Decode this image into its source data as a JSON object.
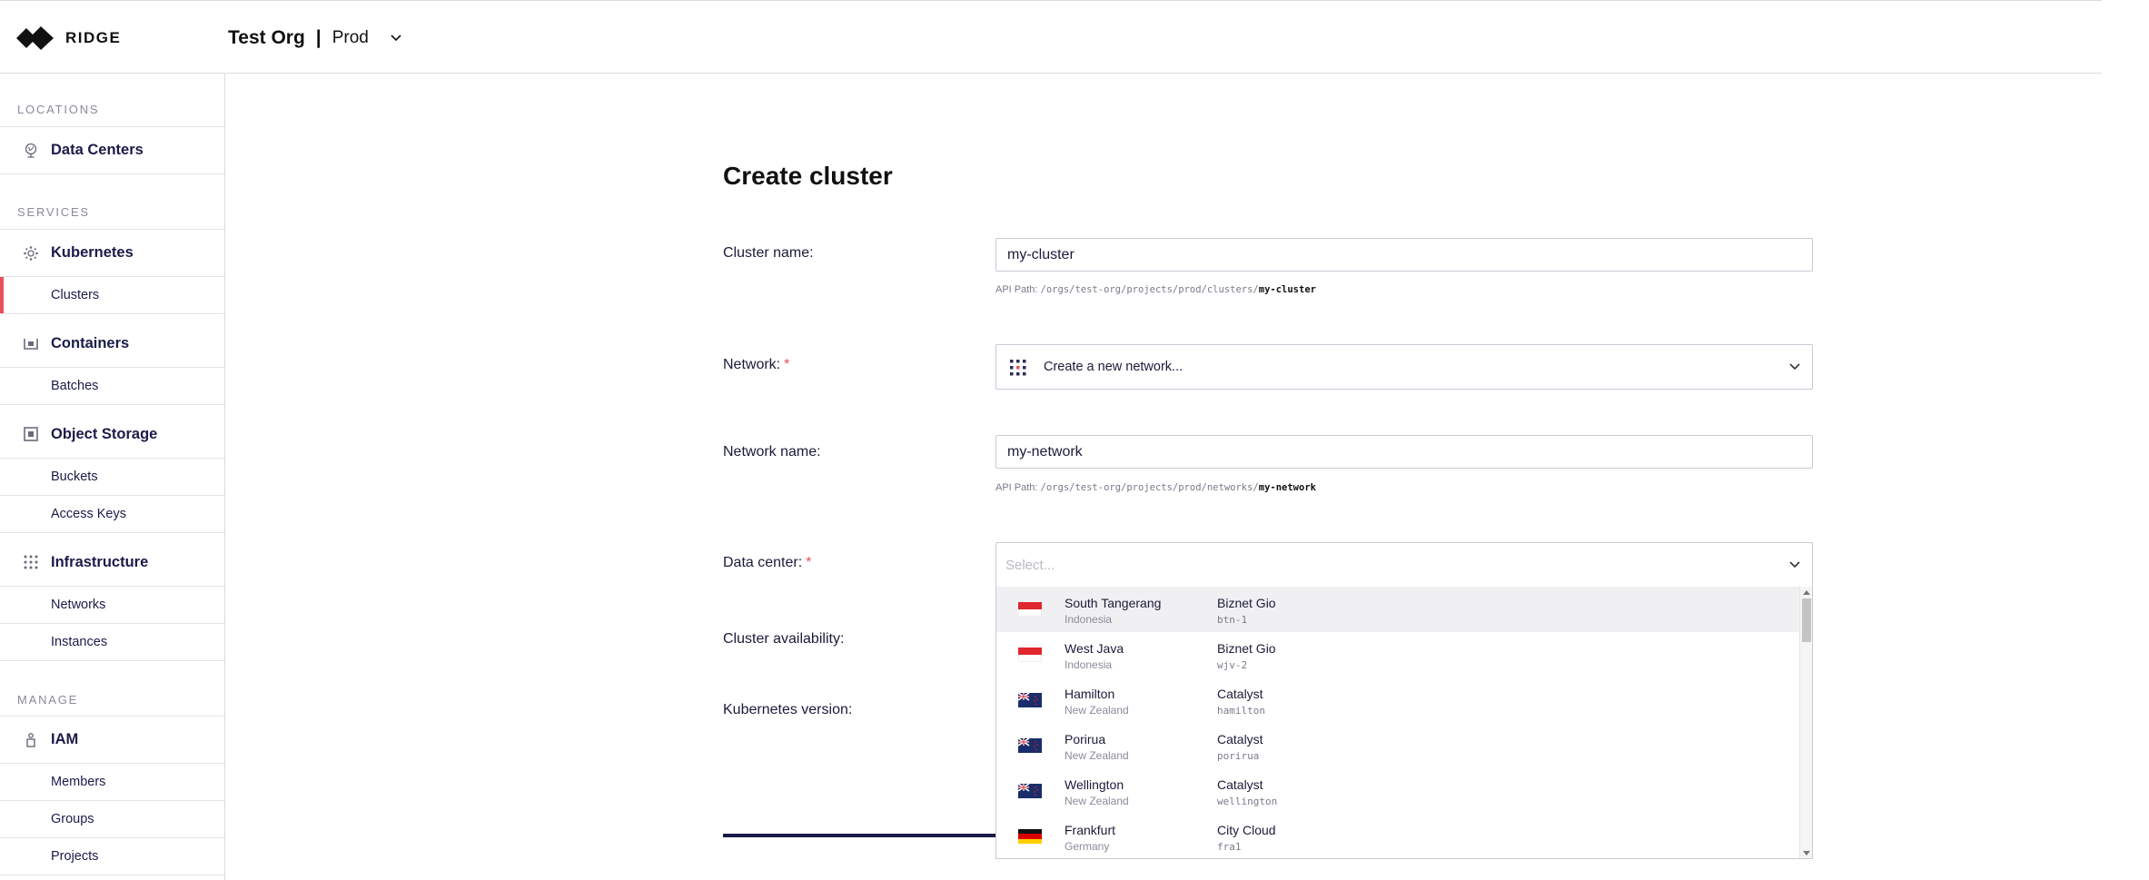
{
  "header": {
    "brand": "RIDGE",
    "org_name": "Test Org",
    "separator": "|",
    "environment": "Prod"
  },
  "sidebar": {
    "sections": {
      "locations": "LOCATIONS",
      "services": "SERVICES",
      "manage": "MANAGE"
    },
    "items": {
      "data_centers": "Data Centers",
      "kubernetes": "Kubernetes",
      "clusters": "Clusters",
      "containers": "Containers",
      "batches": "Batches",
      "object_storage": "Object Storage",
      "buckets": "Buckets",
      "access_keys": "Access Keys",
      "infrastructure": "Infrastructure",
      "networks": "Networks",
      "instances": "Instances",
      "iam": "IAM",
      "members": "Members",
      "groups": "Groups",
      "projects": "Projects"
    },
    "active_item": "Clusters"
  },
  "form": {
    "title": "Create cluster",
    "cluster_name_label": "Cluster name:",
    "cluster_name_value": "my-cluster",
    "cluster_api_prefix": "API Path: ",
    "cluster_api_path": "/orgs/test-org/projects/prod/clusters/",
    "cluster_api_name": "my-cluster",
    "network_label": "Network:",
    "required_mark": "*",
    "network_value": "Create a new network...",
    "network_name_label": "Network name:",
    "network_name_value": "my-network",
    "network_api_prefix": "API Path: ",
    "network_api_path": "/orgs/test-org/projects/prod/networks/",
    "network_api_name": "my-network",
    "data_center_label": "Data center:",
    "data_center_placeholder": "Select...",
    "availability_label": "Cluster availability:",
    "k8s_version_label": "Kubernetes version:"
  },
  "data_center_options": [
    {
      "city": "South Tangerang",
      "country": "Indonesia",
      "provider": "Biznet Gio",
      "code": "btn-1",
      "flag": "indonesia"
    },
    {
      "city": "West Java",
      "country": "Indonesia",
      "provider": "Biznet Gio",
      "code": "wjv-2",
      "flag": "indonesia"
    },
    {
      "city": "Hamilton",
      "country": "New Zealand",
      "provider": "Catalyst",
      "code": "hamilton",
      "flag": "new-zealand"
    },
    {
      "city": "Porirua",
      "country": "New Zealand",
      "provider": "Catalyst",
      "code": "porirua",
      "flag": "new-zealand"
    },
    {
      "city": "Wellington",
      "country": "New Zealand",
      "provider": "Catalyst",
      "code": "wellington",
      "flag": "new-zealand"
    },
    {
      "city": "Frankfurt",
      "country": "Germany",
      "provider": "City Cloud",
      "code": "fra1",
      "flag": "germany"
    }
  ],
  "colors": {
    "accent": "#e8505b",
    "navy": "#1b1b4a",
    "highlight_row": "#f0f0f2"
  }
}
